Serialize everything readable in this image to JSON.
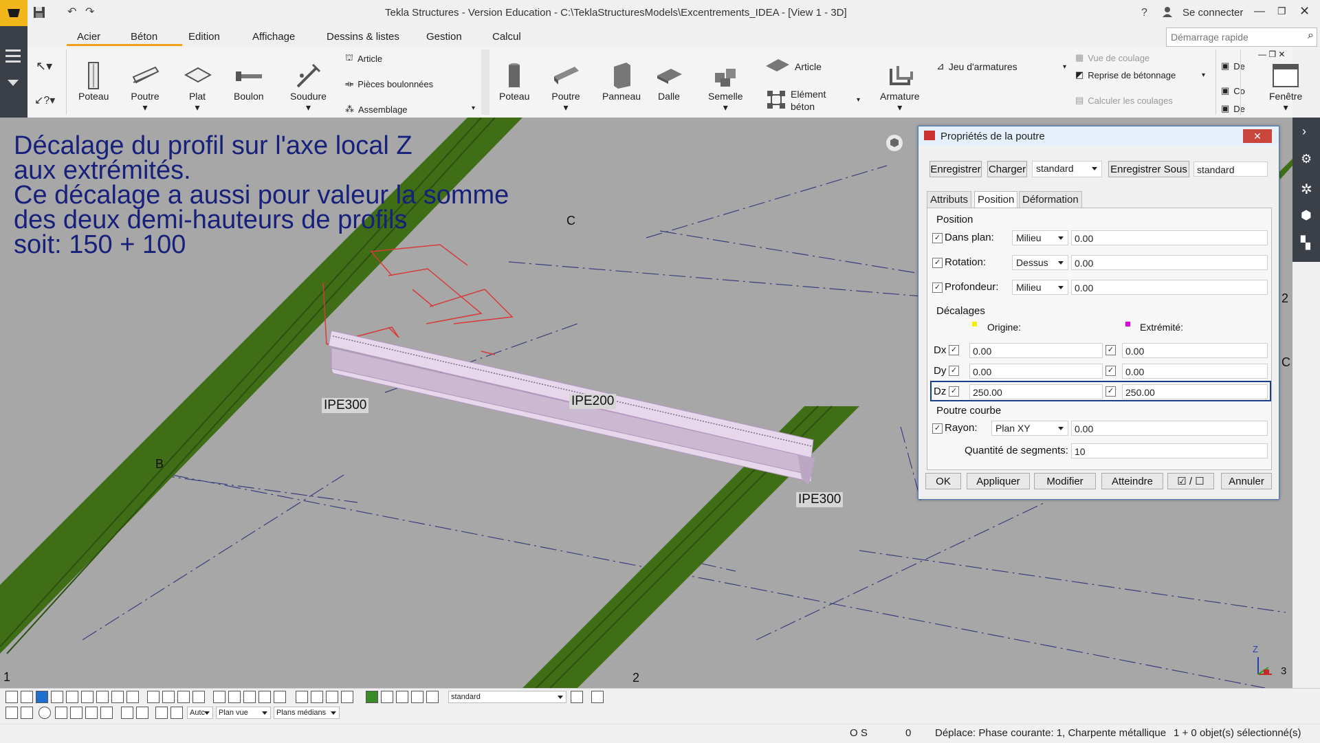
{
  "window": {
    "title": "Tekla Structures - Version Education - C:\\TeklaStructuresModels\\Excentrements_IDEA  - [View 1 - 3D]",
    "help": "?",
    "login": "Se connecter"
  },
  "menu": {
    "tabs": [
      "Acier",
      "Béton",
      "Edition",
      "Affichage",
      "Dessins & listes",
      "Gestion",
      "Calcul"
    ],
    "quick_search_placeholder": "Démarrage rapide"
  },
  "ribbon": {
    "steel": {
      "poteau": "Poteau",
      "poutre": "Poutre",
      "plat": "Plat",
      "boulon": "Boulon",
      "soudure": "Soudure",
      "article": "Article",
      "pieces_boulonnees": "Pièces boulonnées",
      "assemblage": "Assemblage"
    },
    "concrete": {
      "poteau": "Poteau",
      "poutre": "Poutre",
      "panneau": "Panneau",
      "dalle": "Dalle",
      "semelle": "Semelle",
      "article": "Article",
      "element_beton_1": "Elément",
      "element_beton_2": "béton",
      "armature": "Armature",
      "jeu_armatures": "Jeu d'armatures",
      "vue_coulage": "Vue de coulage",
      "reprise_betonnage": "Reprise de bétonnage",
      "calculer_coulages": "Calculer les coulages"
    },
    "fenetre": "Fenêtre",
    "cut_labels": [
      "De",
      "Co",
      "De"
    ]
  },
  "viewport": {
    "overlay_lines": [
      "Décalage du profil sur l'axe local Z",
      "aux extrémités.",
      "Ce décalage a aussi pour valeur la somme",
      "des deux demi-hauteurs de profils",
      "soit: 150 + 100"
    ],
    "profile_labels": {
      "left": "IPE300",
      "middle": "IPE200",
      "right": "IPE300"
    },
    "grid_labels": {
      "c_top": "C",
      "b_left": "B",
      "one_bottom": "1",
      "two_bottom": "2",
      "two_right": "2",
      "c_right": "C",
      "three": "3",
      "axis_z": "Z"
    },
    "colors": {
      "background": "#a7a7a7",
      "column_green": "#3f6e16",
      "beam_pink": "#d8c6dd",
      "text_blue": "#17207a"
    }
  },
  "dialog": {
    "title": "Propriétés de la poutre",
    "top_buttons": {
      "save": "Enregistrer",
      "load": "Charger",
      "preset": "standard",
      "save_as": "Enregistrer Sous",
      "save_as_name": "standard"
    },
    "tabs": [
      "Attributs",
      "Position",
      "Déformation"
    ],
    "position": {
      "heading": "Position",
      "rows": [
        {
          "label": "Dans plan:",
          "option": "Milieu",
          "value": "0.00"
        },
        {
          "label": "Rotation:",
          "option": "Dessus",
          "value": "0.00"
        },
        {
          "label": "Profondeur:",
          "option": "Milieu",
          "value": "0.00"
        }
      ]
    },
    "offsets": {
      "heading": "Décalages",
      "origin": "Origine:",
      "end": "Extrémité:",
      "rows": [
        {
          "label": "Dx",
          "origin": "0.00",
          "end": "0.00"
        },
        {
          "label": "Dy",
          "origin": "0.00",
          "end": "0.00"
        },
        {
          "label": "Dz",
          "origin": "250.00",
          "end": "250.00"
        }
      ]
    },
    "curved": {
      "heading": "Poutre courbe",
      "radius_label": "Rayon:",
      "plane": "Plan XY",
      "radius": "0.00",
      "segments_label": "Quantité de segments:",
      "segments": "10"
    },
    "bottom_buttons": {
      "ok": "OK",
      "apply": "Appliquer",
      "modify": "Modifier",
      "reach": "Atteindre",
      "toggle": "☑ / ☐",
      "cancel": "Annuler"
    }
  },
  "bottom_toolbar": {
    "standard": "standard",
    "auto": "Autc",
    "plan_vue": "Plan vue",
    "plans_medians": "Plans médians"
  },
  "statusbar": {
    "os": "O S",
    "zero": "0",
    "message": "Déplace: Phase courante: 1, Charpente métallique",
    "selection": "1 + 0 objet(s) sélectionné(s)"
  }
}
